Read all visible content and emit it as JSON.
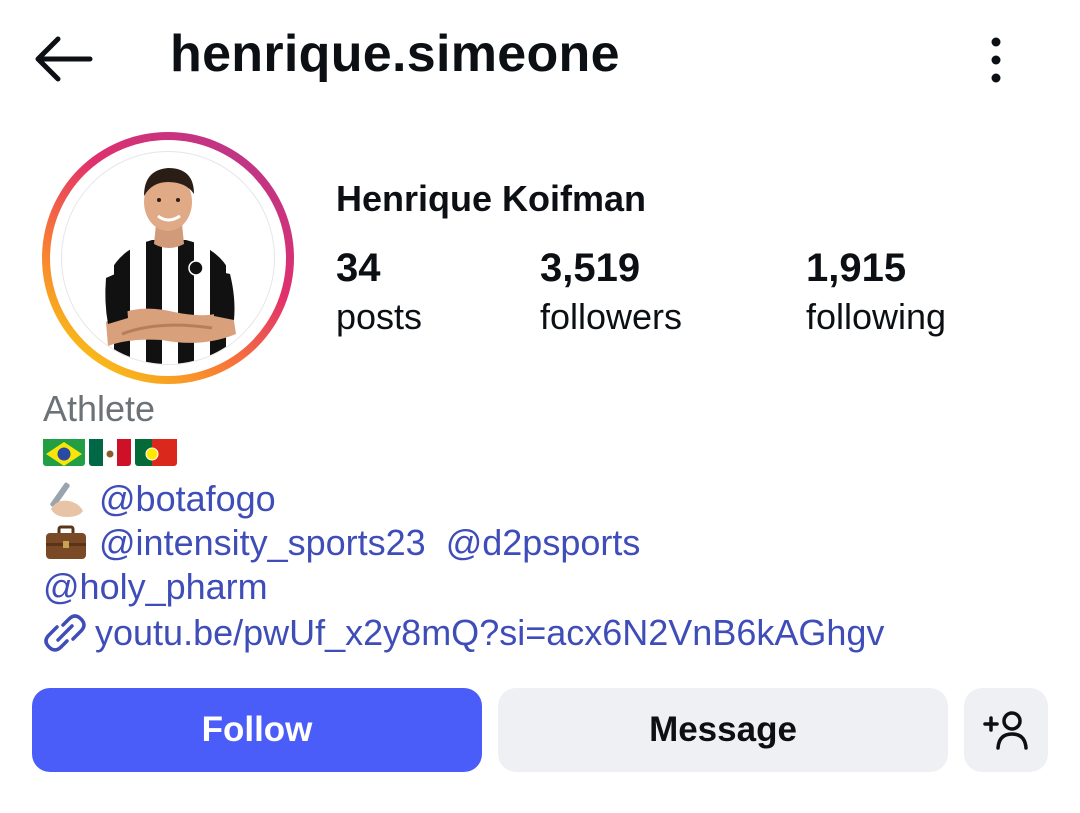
{
  "header": {
    "username": "henrique.simeone",
    "back_icon": "arrow-left-icon",
    "menu_icon": "more-vertical-icon"
  },
  "profile": {
    "full_name": "Henrique Koifman",
    "stats": [
      {
        "value": "34",
        "label": "posts"
      },
      {
        "value": "3,519",
        "label": "followers"
      },
      {
        "value": "1,915",
        "label": "following"
      }
    ]
  },
  "bio": {
    "category": "Athlete",
    "flags": [
      "brazil-flag-icon",
      "mexico-flag-icon",
      "portugal-flag-icon"
    ],
    "line2_icon": "writing-hand-icon",
    "mention_botafogo": "@botafogo",
    "line3_icon": "briefcase-icon",
    "mention_intensity": "@intensity_sports23",
    "mention_d2p": "@d2psports",
    "mention_holy": "@holy_pharm",
    "link_icon": "link-icon",
    "link": "youtu.be/pwUf_x2y8mQ?si=acx6N2VnB6kAGhgv"
  },
  "actions": {
    "follow_label": "Follow",
    "message_label": "Message",
    "suggest_icon": "add-person-icon"
  },
  "colors": {
    "accent": "#4a5df9",
    "mention": "#3f4db8",
    "secondary_button": "#eff0f3",
    "muted_text": "#6b7378"
  }
}
